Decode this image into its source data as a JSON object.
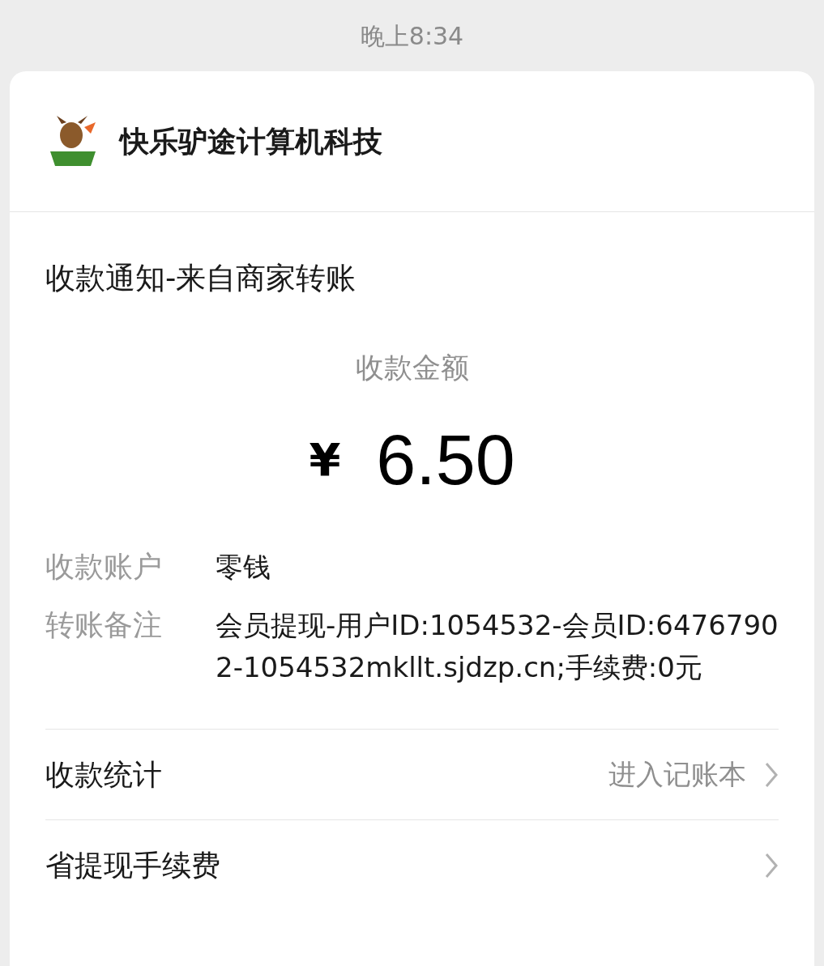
{
  "status_bar": {
    "time": "晚上8:34"
  },
  "merchant": {
    "name": "快乐驴途计算机科技"
  },
  "notice": {
    "title": "收款通知-来自商家转账",
    "amount_label": "收款金额",
    "currency": "¥",
    "amount": "6.50",
    "fields": [
      {
        "label": "收款账户",
        "value": "零钱"
      },
      {
        "label": "转账备注",
        "value": "会员提现-用户ID:1054532-会员ID:64767902-1054532mkllt.sjdzp.cn;手续费:0元"
      }
    ]
  },
  "links": [
    {
      "label": "收款统计",
      "action": "进入记账本"
    },
    {
      "label": "省提现手续费"
    }
  ]
}
